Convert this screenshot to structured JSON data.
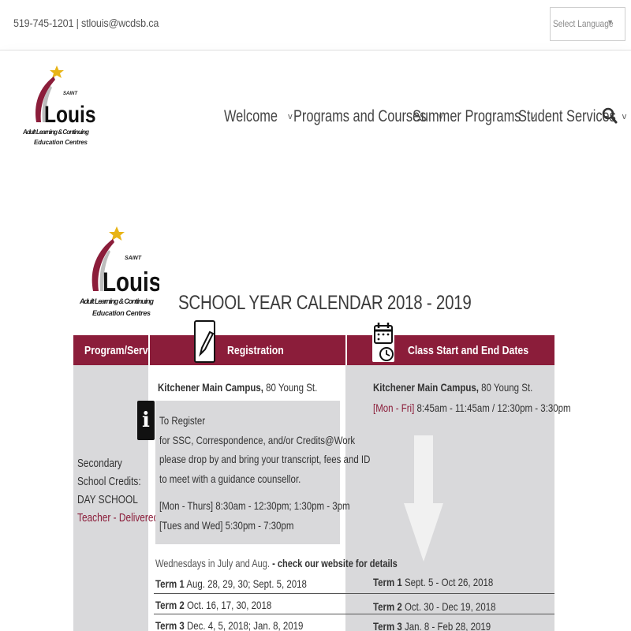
{
  "topbar": {
    "contact": "519-745-1201 | stlouis@wcdsb.ca",
    "language_label": "Select Language",
    "language_caret": "▼"
  },
  "logo": {
    "saint": "SAINT",
    "louis": "Louis",
    "line1": "Adult Learning & Continuing",
    "line2": "Education Centres"
  },
  "nav": {
    "items": [
      {
        "label": "Welcome",
        "chevron": "v"
      },
      {
        "label": "Programs and Courses",
        "chevron": "v"
      },
      {
        "label": "Summer Programs",
        "chevron": "v"
      },
      {
        "label": "Student Services",
        "chevron": "v"
      }
    ],
    "search_icon": "search-icon"
  },
  "calendar": {
    "title": "SCHOOL YEAR CALENDAR 2018 - 2019",
    "headers": {
      "program": "Program/Service",
      "registration": "Registration",
      "class_dates": "Class Start and End Dates"
    },
    "service": {
      "line1": "Secondary",
      "line2": "School Credits:",
      "line3": "DAY SCHOOL",
      "line4": "Teacher - Delivered"
    },
    "campus_name": "Kitchener Main Campus,",
    "campus_address": " 80 Young St.",
    "hours_days": "[Mon - Fri]",
    "hours_times": " 8:45am - 11:45am / 12:30pm - 3:30pm",
    "info_icon": "i",
    "register": {
      "l1": "To Register",
      "l2": "for SSC, Correspondence, and/or Credits@Work",
      "l3": "please drop by and bring your transcript, fees and ID",
      "l4": "to meet with a guidance counsellor.",
      "l5": "[Mon - Thurs] 8:30am - 12:30pm; 1:30pm - 3pm",
      "l6": "[Tues and Wed] 5:30pm - 7:30pm"
    },
    "wed_note_a": "Wednesdays in July and Aug.",
    "wed_note_b": " - check our website for details",
    "reg_terms": [
      {
        "term": "Term 1",
        "dates": " Aug. 28, 29, 30; Sept. 5, 2018"
      },
      {
        "term": "Term 2",
        "dates": " Oct. 16, 17, 30, 2018"
      },
      {
        "term": "Term 3",
        "dates": " Dec. 4, 5, 2018; Jan. 8, 2019"
      }
    ],
    "class_terms": [
      {
        "term": "Term 1",
        "dates": "  Sept. 5 - Oct 26, 2018"
      },
      {
        "term": "Term 2",
        "dates": "  Oct. 30 - Dec 19, 2018"
      },
      {
        "term": "Term 3",
        "dates": "  Jan. 8 - Feb 28, 2019"
      }
    ]
  },
  "colors": {
    "brand": "#8b1d3a",
    "star": "#e8b417",
    "panel_gray": "#d9d9db"
  }
}
